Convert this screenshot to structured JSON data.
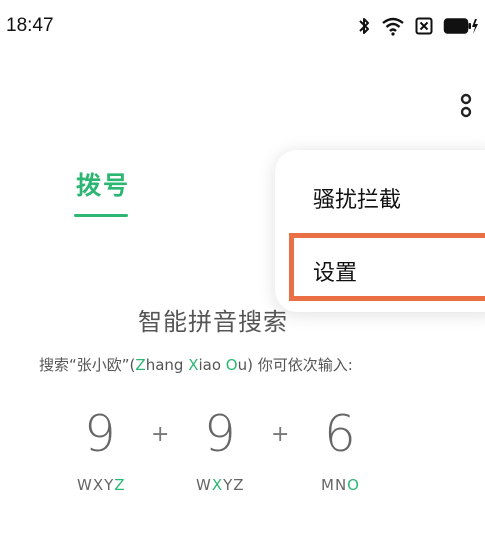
{
  "status_bar": {
    "time": "18:47",
    "icons": [
      "bluetooth-icon",
      "wifi-icon",
      "sim-card-icon",
      "battery-charging-icon"
    ]
  },
  "toolbar": {
    "more_icon": "more-vertical-icon"
  },
  "tabs": {
    "dial_label": "拨号"
  },
  "menu": {
    "items": [
      {
        "label": "骚扰拦截"
      },
      {
        "label": "设置"
      }
    ]
  },
  "colors": {
    "accent": "#2bb673",
    "highlight": "#ea6f45"
  },
  "smart_search": {
    "title": "智能拼音搜索",
    "desc_prefix": "搜索“张小欧”(",
    "desc_z": "Z",
    "desc_hang": "hang ",
    "desc_x": "X",
    "desc_iao": "iao ",
    "desc_o": "O",
    "desc_u": "u",
    "desc_suffix": ") 你可依次输入:",
    "keys": [
      {
        "digit": "9",
        "letters_plain": "WXY",
        "letters_mid": "",
        "letters_hl": "Z",
        "letters_after": ""
      },
      {
        "digit": "9",
        "letters_plain": "W",
        "letters_mid": "",
        "letters_hl": "X",
        "letters_after": "YZ"
      },
      {
        "digit": "6",
        "letters_plain": "MN",
        "letters_mid": "",
        "letters_hl": "O",
        "letters_after": ""
      }
    ],
    "plus": "+"
  }
}
